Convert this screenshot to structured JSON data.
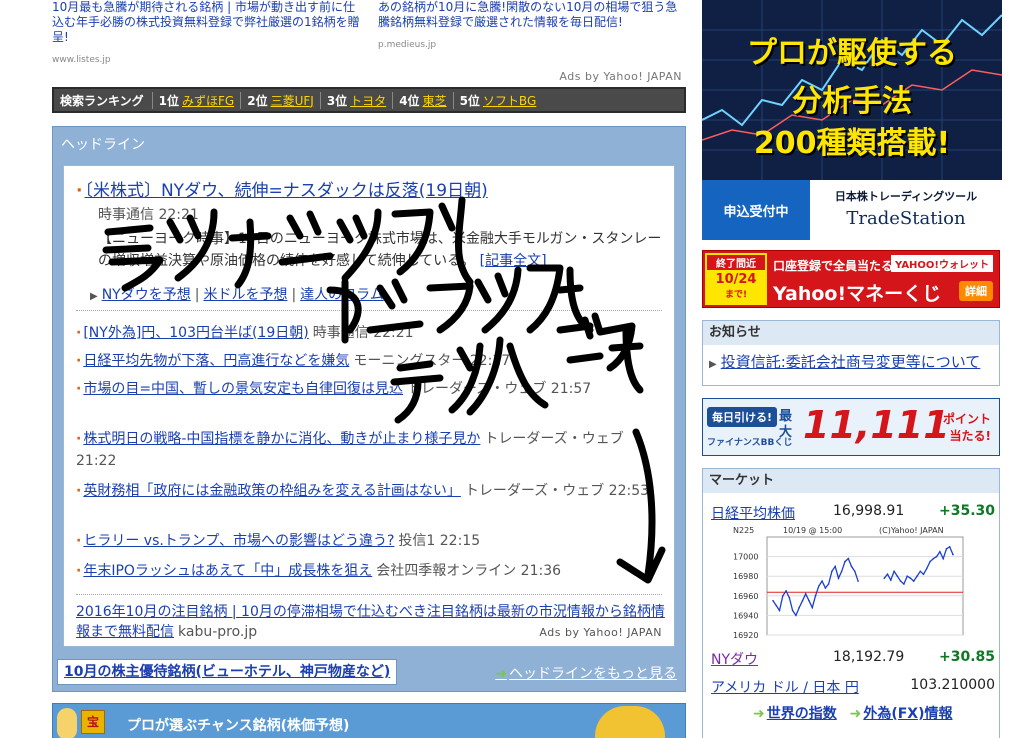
{
  "top_ads": {
    "left": {
      "text": "10月最も急騰が期待される銘柄 | 市場が動き出す前に仕込む年手必勝の株式投資無料登録で弊社厳選の1銘柄を贈呈!",
      "url": "www.listes.jp"
    },
    "right": {
      "text": "あの銘柄が10月に急騰!閑散のない10月の相場で狙う急騰銘柄無料登録で厳選された情報を毎日配信!",
      "url": "p.medieus.jp"
    },
    "ads_by": "Ads by Yahoo! JAPAN"
  },
  "ranking": {
    "title": "検索ランキング",
    "items": [
      {
        "rank": "1位",
        "name": "みずほFG"
      },
      {
        "rank": "2位",
        "name": "三菱UFJ"
      },
      {
        "rank": "3位",
        "name": "トヨタ"
      },
      {
        "rank": "4位",
        "name": "東芝"
      },
      {
        "rank": "5位",
        "name": "ソフトBG"
      }
    ]
  },
  "headlines": {
    "title": "ヘッドライン",
    "main": {
      "title": "〔米株式〕NYダウ、続伸=ナスダックは反落(19日朝)",
      "source": "時事通信 22:21",
      "summary": "【ニューヨーク時事】19日のニューヨーク株式市場は、米金融大手モルガン・スタンレーの増収増益決算や原油価格の続伸を好感して続伸している。",
      "full_link": "[記事全文]"
    },
    "sublinks": [
      "NYダウを予想",
      "米ドルを予想",
      "達人のコラム"
    ],
    "items": [
      {
        "title": "[NY外為]円、103円台半ば(19日朝)",
        "source": "時事通信 22:21"
      },
      {
        "title": "日経平均先物が下落、円高進行などを嫌気",
        "source": "モーニングスター 22:17"
      },
      {
        "title": "市場の目=中国、暫しの景気安定も自律回復は見込",
        "source": "トレーダーズ・ウェブ 21:57"
      },
      {
        "title": "株式明日の戦略-中国指標を静かに消化、動きが止まり様子見か",
        "source": "トレーダーズ・ウェブ 21:22"
      },
      {
        "title": "英財務相「政府には金融政策の枠組みを変える計画はない」",
        "source": "トレーダーズ・ウェブ 22:53"
      },
      {
        "title": "ヒラリー vs.トランプ、市場への影響はどう違う?",
        "source": "投信1 22:15"
      },
      {
        "title": "年末IPOラッシュはあえて「中」成長株を狙え",
        "source": "会社四季報オンライン 21:36"
      }
    ],
    "ad": {
      "title": "2016年10月の注目銘柄 | 10月の停滞相場で仕込むべき注目銘柄は最新の市況情報から銘柄情報まで無料配信",
      "domain": "kabu-pro.jp",
      "ads_by": "Ads by Yahoo! JAPAN"
    },
    "footer_button": "10月の株主優待銘柄(ビューホテル、神戸物産など)",
    "more_link": "ヘッドラインをもっと見る"
  },
  "promo": {
    "badge": "宝",
    "text": "プロが選ぶチャンス銘柄(株価予想)"
  },
  "banner_tradestation": {
    "line1": "プロが駆使する",
    "line2": "分析手法",
    "line3": "200種類搭載!",
    "apply": "申込受付中",
    "brand_small": "日本株トレーディングツール",
    "brand": "TradeStation"
  },
  "banner_moneykuji": {
    "deadline_label": "終了間近",
    "deadline": "10/24",
    "deadline_suffix": "まで!",
    "top": "口座登録で全員当たる",
    "yahoo": "YAHOO!ウォレット",
    "main": "Yahoo!マネーくじ",
    "detail": "詳細"
  },
  "notice": {
    "title": "お知らせ",
    "item": "投資信託:委託会社商号変更等について"
  },
  "banner_mainichi": {
    "logo": "毎日引ける!",
    "logo2": "ファイナンスBBくじ",
    "pre": "最大",
    "big": "11,111",
    "post1": "ポイント",
    "post2": "当たる!"
  },
  "market": {
    "title": "マーケット",
    "rows": [
      {
        "name": "日経平均株価",
        "value": "16,998.91",
        "change": "+35.30"
      },
      {
        "name": "NYダウ",
        "value": "18,192.79",
        "change": "+30.85"
      },
      {
        "name": "アメリカ ドル / 日本 円",
        "value": "103.210000",
        "change": ""
      }
    ],
    "chart": {
      "label": "N225",
      "date": "10/19 @ 15:00",
      "copyright": "(C)Yahoo! JAPAN",
      "yticks": [
        "17000",
        "16980",
        "16960",
        "16940",
        "16920"
      ]
    },
    "links": [
      "世界の指数",
      "外為(FX)情報"
    ]
  },
  "chart_data": {
    "type": "line",
    "title": "N225",
    "ylim": [
      16920,
      17020
    ],
    "prev_close": 16963.61,
    "x": [
      0,
      1,
      2,
      3,
      4,
      5,
      6,
      7,
      8,
      9,
      10,
      11,
      12,
      13,
      14,
      15,
      16,
      17,
      18,
      19,
      20,
      21,
      22,
      23,
      24,
      25,
      26,
      27,
      28,
      29,
      30,
      31,
      32,
      33,
      34,
      35,
      36,
      37,
      38,
      39,
      40,
      41,
      42,
      43,
      44,
      45,
      46,
      47,
      48,
      49,
      50,
      51,
      52,
      53,
      54,
      55
    ],
    "values": [
      16955,
      16950,
      16945,
      16960,
      16965,
      16958,
      16945,
      16940,
      16948,
      16955,
      16962,
      16955,
      16948,
      16960,
      16970,
      16975,
      16968,
      16972,
      16985,
      16990,
      16978,
      16985,
      16995,
      16998,
      16990,
      16985,
      16975,
      null,
      null,
      null,
      null,
      null,
      null,
      null,
      16978,
      16982,
      16976,
      16985,
      16980,
      16975,
      16972,
      16980,
      16978,
      16975,
      16980,
      16985,
      16982,
      16988,
      16995,
      16998,
      17000,
      17005,
      16998,
      17008,
      17010,
      17002
    ]
  }
}
